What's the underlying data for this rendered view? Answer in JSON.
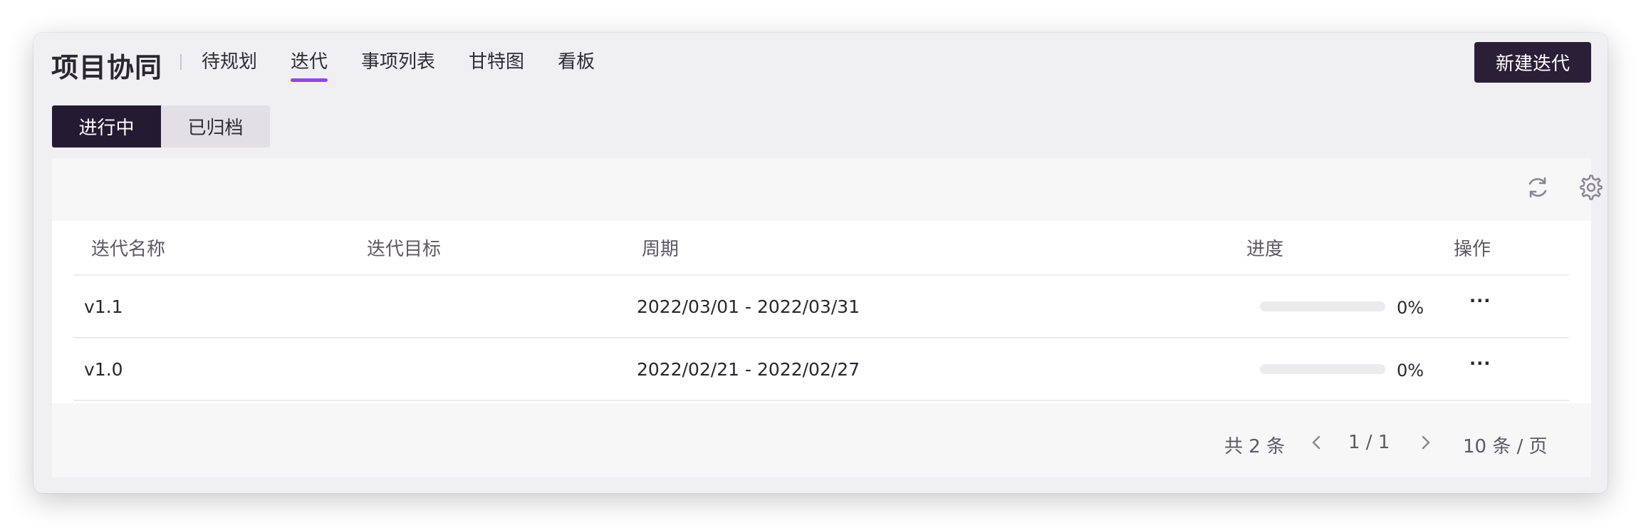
{
  "header": {
    "brand": "项目协同",
    "tabs": [
      {
        "label": "待规划"
      },
      {
        "label": "迭代"
      },
      {
        "label": "事项列表"
      },
      {
        "label": "甘特图"
      },
      {
        "label": "看板"
      }
    ],
    "active_tab": "迭代",
    "new_button": "新建迭代"
  },
  "segments": {
    "active": "进行中",
    "inactive": "已归档"
  },
  "toolbar": {
    "icons": [
      "refresh-icon",
      "settings-icon"
    ]
  },
  "table": {
    "columns": [
      "迭代名称",
      "迭代目标",
      "周期",
      "进度",
      "操作"
    ],
    "rows": [
      {
        "name": "v1.1",
        "goal": "",
        "period": "2022/03/01 - 2022/03/31",
        "progress": "0%",
        "action": "···"
      },
      {
        "name": "v1.0",
        "goal": "",
        "period": "2022/02/21 - 2022/02/27",
        "progress": "0%",
        "action": "···"
      }
    ]
  },
  "pagination": {
    "total": "共 2 条",
    "page": "1 / 1",
    "page_size": "10 条 / 页"
  },
  "colors": {
    "accent": "#9147e6",
    "primary_dark": "#2a1f37"
  }
}
